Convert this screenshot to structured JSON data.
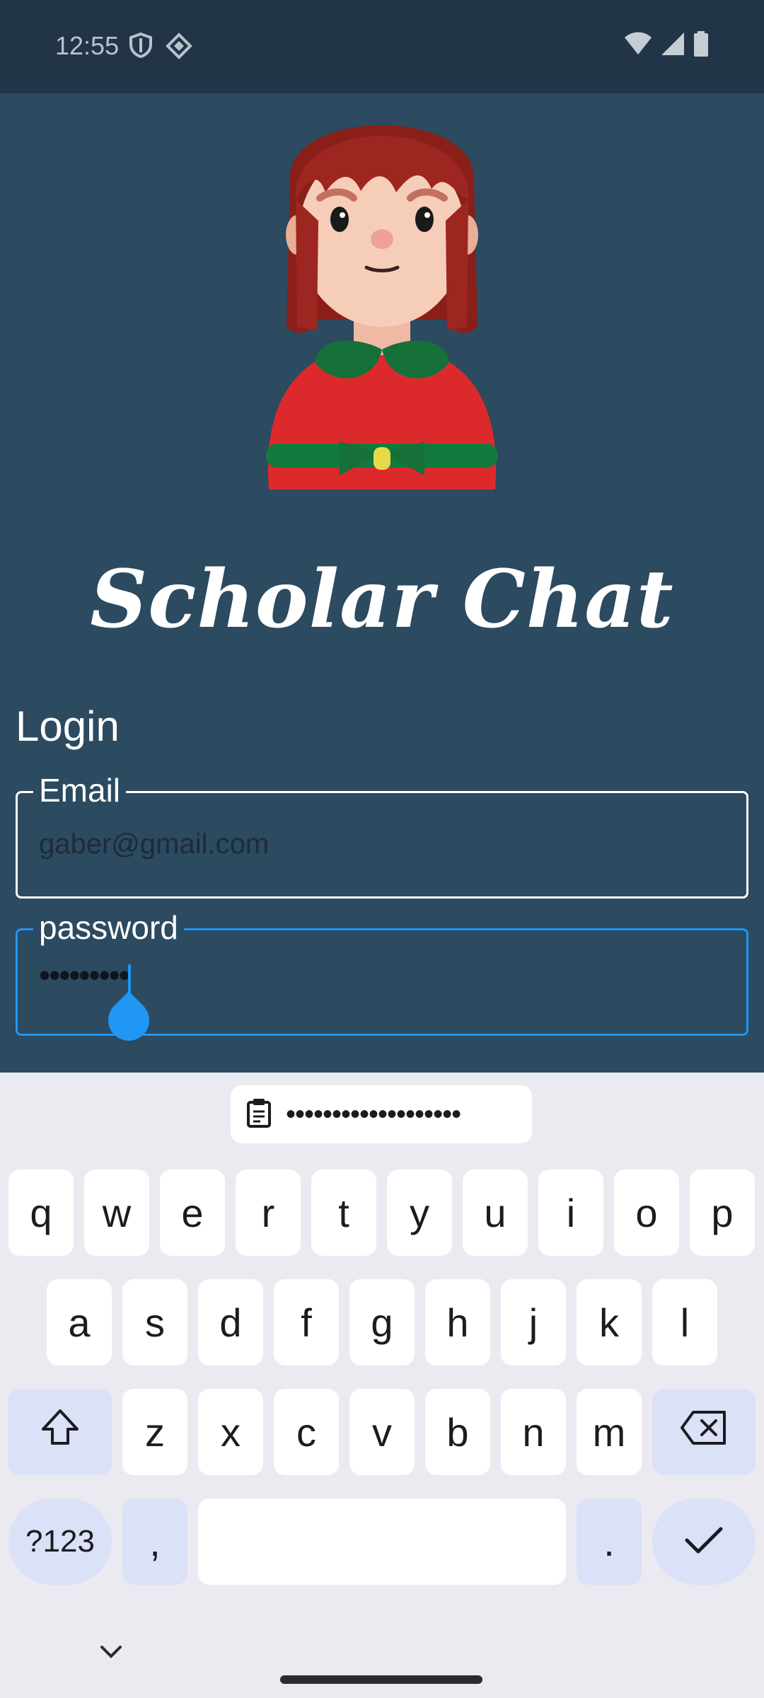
{
  "status_bar": {
    "time": "12:55",
    "icons": [
      "shield-icon",
      "diamond-icon",
      "wifi-icon",
      "signal-icon",
      "battery-icon"
    ]
  },
  "app": {
    "title": "Scholar Chat",
    "section_title": "Login",
    "email": {
      "label": "Email",
      "value": "gaber@gmail.com"
    },
    "password": {
      "label": "password",
      "value": "•••••••••"
    }
  },
  "keyboard": {
    "suggestion": "•••••••••••••••••••",
    "row1": [
      "q",
      "w",
      "e",
      "r",
      "t",
      "y",
      "u",
      "i",
      "o",
      "p"
    ],
    "row2": [
      "a",
      "s",
      "d",
      "f",
      "g",
      "h",
      "j",
      "k",
      "l"
    ],
    "row3": [
      "z",
      "x",
      "c",
      "v",
      "b",
      "n",
      "m"
    ],
    "symbols_label": "?123",
    "comma": ",",
    "period": "."
  },
  "colors": {
    "app_bg": "#2c4a60",
    "accent": "#2196f3",
    "keyboard_bg": "#eceaf1"
  }
}
